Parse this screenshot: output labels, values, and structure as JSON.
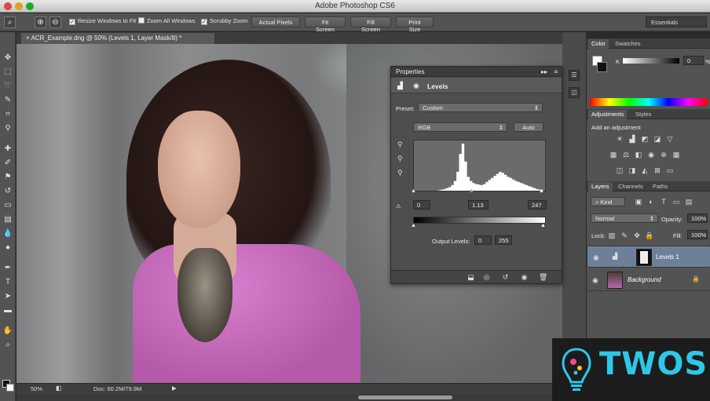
{
  "window": {
    "title": "Adobe Photoshop CS6"
  },
  "options_bar": {
    "resize_windows": {
      "label": "Resize Windows to Fit",
      "checked": true
    },
    "zoom_all": {
      "label": "Zoom All Windows",
      "checked": false
    },
    "scrubby": {
      "label": "Scrubby Zoom",
      "checked": true
    },
    "buttons": [
      "Actual Pixels",
      "Fit Screen",
      "Fill Screen",
      "Print Size"
    ],
    "workspace": "Essentials"
  },
  "document": {
    "tab_title": "ACR_Example.dng @ 50% (Levels 1, Layer Mask/8) *",
    "zoom": "50%",
    "doc_info": "Doc: 60.2M/79.9M"
  },
  "properties": {
    "tab": "Properties",
    "header": "Levels",
    "preset_label": "Preset:",
    "preset_value": "Custom",
    "channel": "RGB",
    "auto_label": "Auto",
    "input_black": "0",
    "input_gamma": "1.13",
    "input_white": "247",
    "output_label": "Output Levels:",
    "output_black": "0",
    "output_white": "255",
    "histogram": [
      0,
      0,
      0,
      1,
      1,
      2,
      2,
      3,
      3,
      4,
      5,
      6,
      8,
      10,
      14,
      22,
      40,
      75,
      95,
      60,
      30,
      22,
      18,
      16,
      15,
      14,
      16,
      20,
      24,
      28,
      32,
      36,
      40,
      38,
      34,
      30,
      28,
      25,
      22,
      20,
      18,
      16,
      14,
      12,
      10,
      8,
      6,
      5,
      4,
      3
    ]
  },
  "color_panel": {
    "tabs": [
      "Color",
      "Swatches"
    ],
    "k_label": "K",
    "k_value": "0",
    "k_unit": "%"
  },
  "adjustments_panel": {
    "tabs": [
      "Adjustments",
      "Styles"
    ],
    "hint": "Add an adjustment"
  },
  "layers_panel": {
    "tabs": [
      "Layers",
      "Channels",
      "Paths"
    ],
    "kind": "Kind",
    "blend_mode": "Normal",
    "opacity_label": "Opacity:",
    "opacity_value": "100%",
    "lock_label": "Lock:",
    "fill_label": "Fill:",
    "fill_value": "100%",
    "layers": [
      {
        "name": "Levels 1",
        "selected": true
      },
      {
        "name": "Background",
        "selected": false
      }
    ]
  },
  "watermark": {
    "text": "TWOS"
  },
  "icons": {
    "zoom": "magnifier-icon",
    "eye": "eye-icon",
    "lock": "lock-icon"
  }
}
